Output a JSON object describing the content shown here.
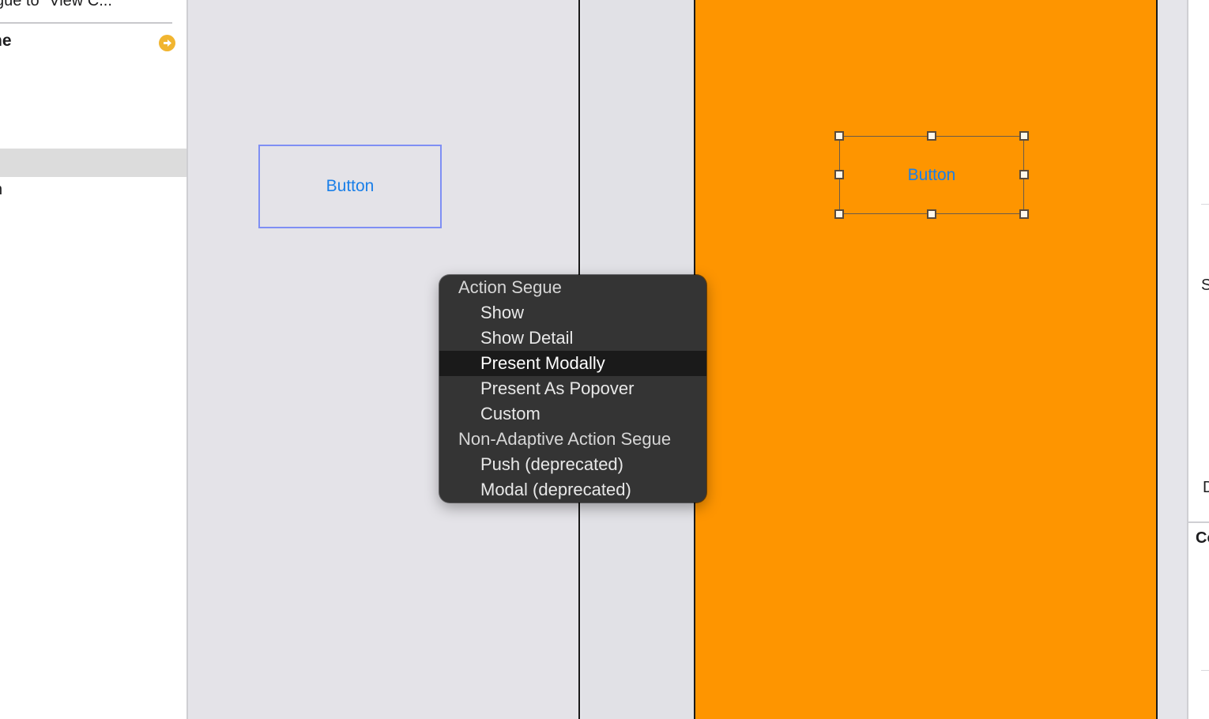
{
  "outline": {
    "segue_label": "gue to \"View C...",
    "scene_label": "ne",
    "row_label": "n"
  },
  "canvas": {
    "left_button_label": "Button",
    "right_button_label": "Button",
    "right_background_color": "#fe9500",
    "selection_color": "#7f8ff4"
  },
  "inspector": {
    "label_s": "S",
    "label_d": "D",
    "label_co": "Co"
  },
  "segue_menu": {
    "sections": [
      {
        "header": "Action Segue",
        "items": [
          "Show",
          "Show Detail",
          "Present Modally",
          "Present As Popover",
          "Custom"
        ]
      },
      {
        "header": "Non-Adaptive Action Segue",
        "items": [
          "Push (deprecated)",
          "Modal (deprecated)"
        ]
      }
    ],
    "highlighted_item": "Present Modally"
  }
}
